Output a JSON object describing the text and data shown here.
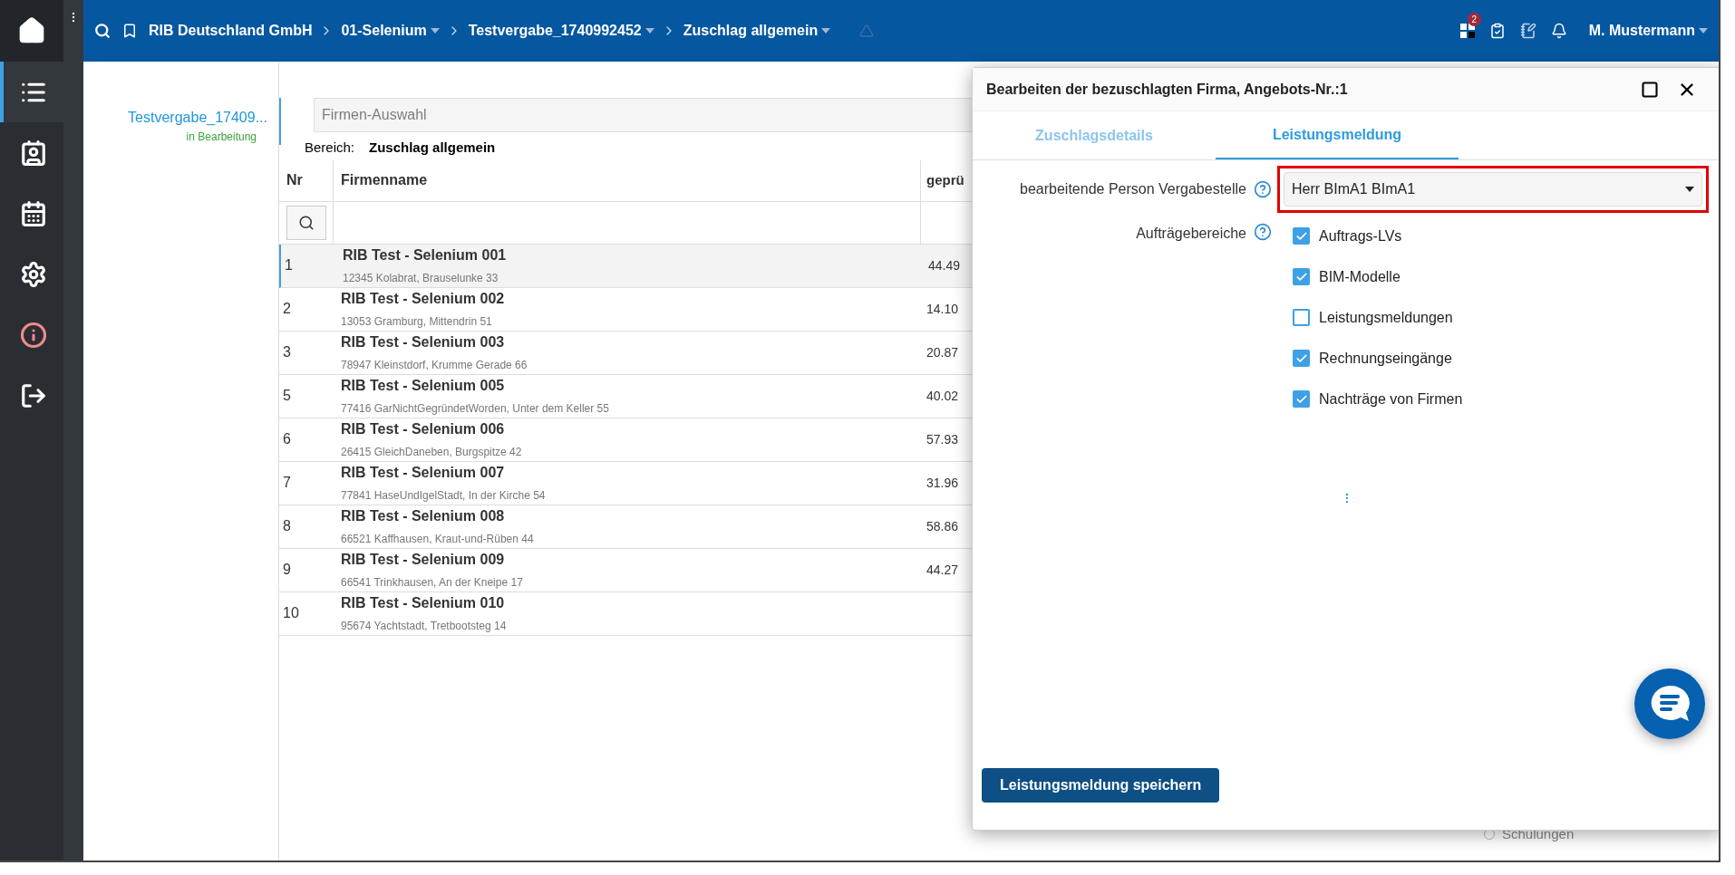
{
  "topbar": {
    "breadcrumbs": [
      {
        "label": "RIB Deutschland GmbH",
        "dropdown": false
      },
      {
        "label": "01-Selenium",
        "dropdown": true
      },
      {
        "label": "Testvergabe_1740992452",
        "dropdown": true
      },
      {
        "label": "Zuschlag allgemein",
        "dropdown": true
      }
    ],
    "badge": "2",
    "user": "M. Mustermann"
  },
  "sidebar": {
    "items": [
      {
        "kind": "list",
        "selected": true
      },
      {
        "kind": "contacts",
        "selected": false
      },
      {
        "kind": "calendar",
        "selected": false
      },
      {
        "kind": "settings",
        "selected": false
      },
      {
        "kind": "info",
        "selected": false
      },
      {
        "kind": "logout",
        "selected": false
      }
    ]
  },
  "project": {
    "title": "Testvergabe_17409...",
    "status": "in Bearbeitung"
  },
  "table": {
    "search": {
      "placeholder": "Firmen-Auswahl"
    },
    "area_label": "Bereich:",
    "area_value": "Zuschlag allgemein",
    "columns": [
      "Nr",
      "Firmenname",
      "geprü"
    ],
    "rows": [
      {
        "nr": "1",
        "name": "RIB Test - Selenium 001",
        "address": "12345 Kolabrat, Brauselunke 33",
        "value": "44.49",
        "selected": true
      },
      {
        "nr": "2",
        "name": "RIB Test - Selenium 002",
        "address": "13053 Gramburg, Mittendrin 51",
        "value": "14.10",
        "selected": false
      },
      {
        "nr": "3",
        "name": "RIB Test - Selenium 003",
        "address": "78947 Kleinstdorf, Krumme Gerade 66",
        "value": "20.87",
        "selected": false
      },
      {
        "nr": "5",
        "name": "RIB Test - Selenium 005",
        "address": "77416 GarNichtGegründetWorden, Unter dem Keller 55",
        "value": "40.02",
        "selected": false
      },
      {
        "nr": "6",
        "name": "RIB Test - Selenium 006",
        "address": "26415 GleichDaneben, Burgspitze 42",
        "value": "57.93",
        "selected": false
      },
      {
        "nr": "7",
        "name": "RIB Test - Selenium 007",
        "address": "77841 HaseUndIgelStadt, In der Kirche 54",
        "value": "31.96",
        "selected": false
      },
      {
        "nr": "8",
        "name": "RIB Test - Selenium 008",
        "address": "66521 Kaffhausen, Kraut-und-Rüben 44",
        "value": "58.86",
        "selected": false
      },
      {
        "nr": "9",
        "name": "RIB Test - Selenium 009",
        "address": "66541 Trinkhausen, An der Kneipe 17",
        "value": "44.27",
        "selected": false
      },
      {
        "nr": "10",
        "name": "RIB Test - Selenium 010",
        "address": "95674 Yachtstadt, Tretbootsteg 14",
        "selected": false
      }
    ]
  },
  "background_option": {
    "label": "Schulungen",
    "selected": false
  },
  "dialog": {
    "title": "Bearbeiten der bezuschlagten Firma, Angebots-Nr.:1",
    "tabs": [
      {
        "label": "Zuschlagsdetails",
        "selected": false
      },
      {
        "label": "Leistungsmeldung",
        "selected": true
      }
    ],
    "person": {
      "label": "bearbeitende Person Vergabestelle",
      "value": "Herr BImA1 BImA1",
      "highlighted": true
    },
    "areas": {
      "label": "Aufträgebereiche",
      "options": [
        {
          "label": "Auftrags-LVs",
          "checked": true
        },
        {
          "label": "BIM-Modelle",
          "checked": true
        },
        {
          "label": "Leistungsmeldungen",
          "checked": false
        },
        {
          "label": "Rechnungseingänge",
          "checked": true
        },
        {
          "label": "Nachträge von Firmen",
          "checked": true
        }
      ]
    },
    "save_button": "Leistungsmeldung speichern"
  }
}
